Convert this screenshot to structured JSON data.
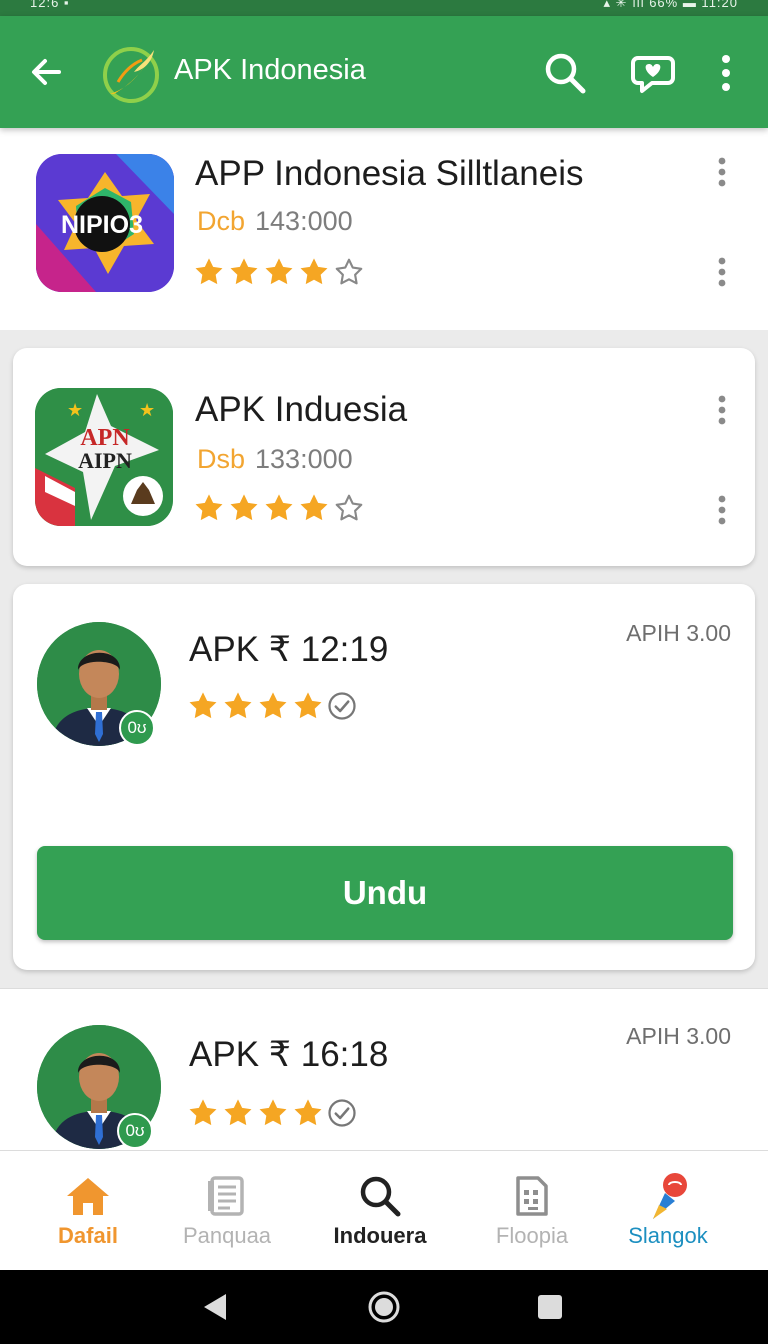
{
  "status_bar": {
    "left_text": "12:6 ▪",
    "right_text": "▴ ✳ ıll 66% ▬ 11:20"
  },
  "app_bar": {
    "title": "APK Indonesia",
    "back_icon": "arrow-left-icon",
    "logo_icon": "leaf-swirl-logo-icon",
    "search_icon": "search-icon",
    "chat_icon": "chat-heart-icon",
    "more_icon": "more-vertical-icon"
  },
  "items": [
    {
      "name": "APP Indonesia Silltlaneis",
      "sub_label": "Dcb",
      "sub_count": "143:000",
      "rating": 4,
      "icon_text": "NIPIO3"
    },
    {
      "name": "APK Induesia",
      "sub_label": "Dsb",
      "sub_count": "133:000",
      "rating": 4,
      "icon_text": "APN"
    },
    {
      "name": "APK ₹ 12:19",
      "version": "APIH 3.00",
      "rating": 4,
      "badge": "0ʊ",
      "button_label": "Undu"
    },
    {
      "name": "APK ₹ 16:18",
      "version": "APIH 3.00",
      "rating": 4,
      "badge": "0ʊ"
    }
  ],
  "bottom_nav": [
    {
      "label": "Dafail",
      "icon": "home-icon",
      "color": "#f0962f",
      "active": true
    },
    {
      "label": "Panquaa",
      "icon": "document-icon",
      "color": "#b3b3b3",
      "active": false
    },
    {
      "label": "Indouera",
      "icon": "search-icon",
      "color": "#222222",
      "active": false
    },
    {
      "label": "Floopia",
      "icon": "file-grid-icon",
      "color": "#b3b3b3",
      "active": false
    },
    {
      "label": "Slangok",
      "icon": "location-pin-icon",
      "color": "#1c8fc0",
      "active": false
    }
  ],
  "colors": {
    "primary": "#34a154",
    "star": "#f5a623",
    "accent_orange": "#f0962f"
  }
}
